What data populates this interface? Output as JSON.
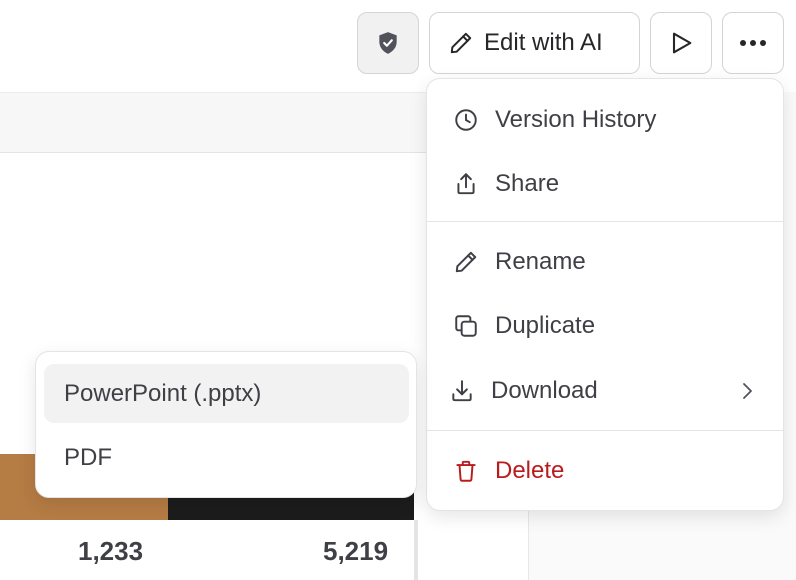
{
  "toolbar": {
    "shield_icon": "shield-check-icon",
    "edit_label": "Edit with AI",
    "edit_icon": "pencil-icon",
    "present_icon": "play-icon",
    "more_icon": "more-horizontal-icon"
  },
  "chart": {
    "values": [
      "1,233",
      "5,219"
    ],
    "colors": [
      "#b57c44",
      "#1c1c1c"
    ]
  },
  "menu": {
    "items": [
      {
        "label": "Version History",
        "icon": "clock-icon"
      },
      {
        "label": "Share",
        "icon": "share-icon"
      },
      {
        "label": "Rename",
        "icon": "pencil-icon"
      },
      {
        "label": "Duplicate",
        "icon": "copy-icon"
      },
      {
        "label": "Download",
        "icon": "download-icon"
      },
      {
        "label": "Delete",
        "icon": "trash-icon"
      }
    ],
    "delete_color": "#b91c1c"
  },
  "download_submenu": {
    "items": [
      {
        "label": "PowerPoint (.pptx)"
      },
      {
        "label": "PDF"
      }
    ]
  }
}
